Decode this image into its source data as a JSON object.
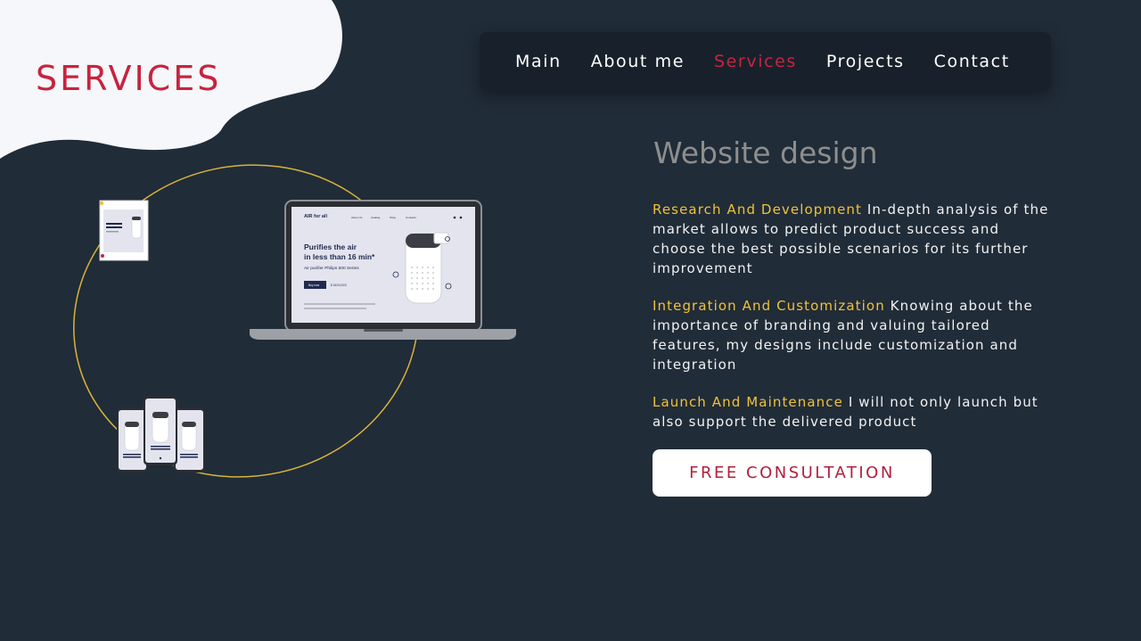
{
  "page": {
    "title": "SERVICES"
  },
  "nav": {
    "items": [
      {
        "label": "Main",
        "active": false
      },
      {
        "label": "About me",
        "active": false
      },
      {
        "label": "Services",
        "active": true
      },
      {
        "label": "Projects",
        "active": false
      },
      {
        "label": "Contact",
        "active": false
      }
    ]
  },
  "section": {
    "title": "Website design"
  },
  "services": [
    {
      "heading": "Research And Development",
      "text": " In-depth analysis of the market allows to predict product success and choose the best possible scenarios for its further improvement"
    },
    {
      "heading": "Integration And Customization",
      "text": " Knowing about the importance of branding and valuing tailored features, my designs include customization and integration"
    },
    {
      "heading": "Launch And Maintenance",
      "text": " I will not only launch but also support the delivered product"
    }
  ],
  "cta": {
    "label": "FREE CONSULTATION"
  },
  "mockup": {
    "brand": "AIR for all",
    "nav": [
      "About Us",
      "Catalog",
      "Shop",
      "Contacts"
    ],
    "headline_1": "Purifies the air",
    "headline_2": "in less than 16 min*",
    "subheadline": "Air purifier Philips 600 Series",
    "buy_label": "Buy now",
    "price": "$ 1623,0103"
  },
  "colors": {
    "background": "#202c38",
    "accent_red": "#c8233f",
    "highlight_yellow": "#f0c23b",
    "nav_bg": "#18212b"
  }
}
